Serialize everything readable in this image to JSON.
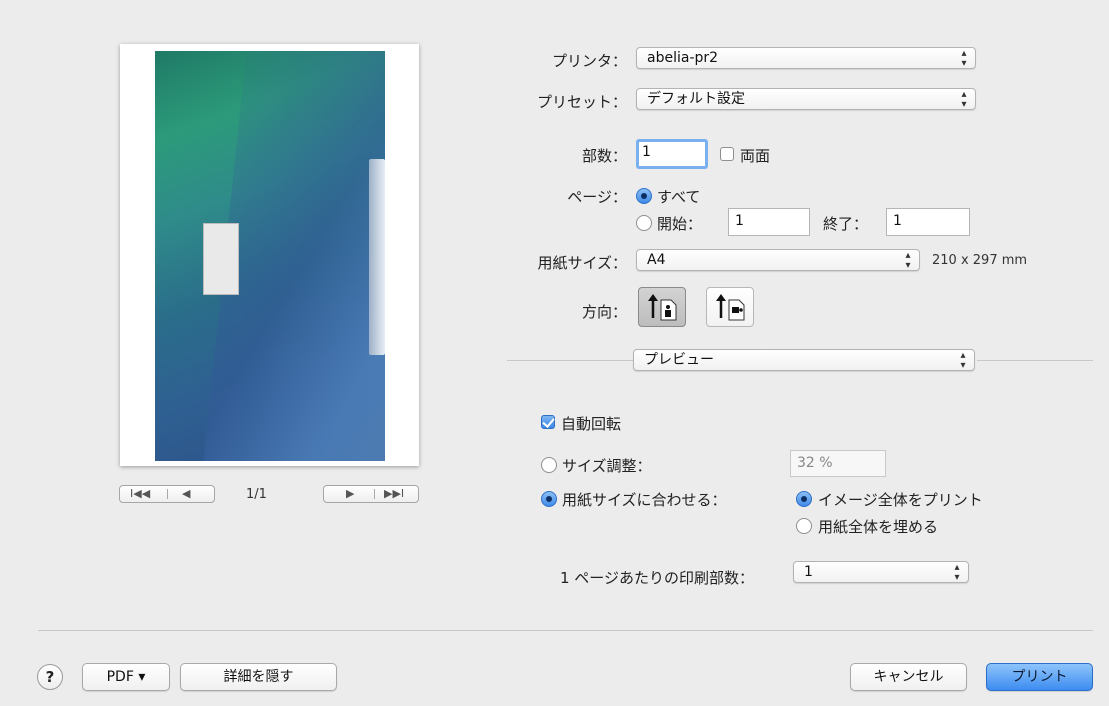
{
  "printer": {
    "label": "プリンタ：",
    "value": "abelia-pr2"
  },
  "preset": {
    "label": "プリセット：",
    "value": "デフォルト設定"
  },
  "copies": {
    "label": "部数：",
    "value": "1",
    "duplex_label": "両面",
    "duplex_checked": false
  },
  "pages": {
    "label": "ページ：",
    "all_label": "すべて",
    "range_label": "開始：",
    "from_value": "1",
    "to_label": "終了：",
    "to_value": "1",
    "selected": "all"
  },
  "paper_size": {
    "label": "用紙サイズ：",
    "value": "A4",
    "dimensions": "210 x 297 mm"
  },
  "orientation": {
    "label": "方向：",
    "selected": "portrait",
    "options": [
      "portrait",
      "landscape"
    ]
  },
  "section_popup": {
    "value": "プレビュー"
  },
  "preview_settings": {
    "auto_rotate": {
      "label": "自動回転",
      "checked": true
    },
    "scale": {
      "label": "サイズ調整：",
      "value": "32 %",
      "selected": false
    },
    "fit": {
      "label": "用紙サイズに合わせる：",
      "selected": true
    },
    "fit_options": [
      {
        "label": "イメージ全体をプリント",
        "selected": true
      },
      {
        "label": "用紙全体を埋める",
        "selected": false
      }
    ],
    "pages_per_sheet": {
      "label": "1 ページあたりの印刷部数：",
      "value": "1"
    }
  },
  "preview_nav": {
    "first": "I◀◀",
    "prev": "◀",
    "page_indicator": "1/1",
    "next": "▶",
    "last": "▶▶I"
  },
  "footer": {
    "help": "?",
    "pdf_label": "PDF ▾",
    "hide_details_label": "詳細を隠す",
    "cancel_label": "キャンセル",
    "print_label": "プリント"
  },
  "icons": [
    "help-icon",
    "portrait-icon",
    "landscape-icon",
    "popup-arrows-icon"
  ],
  "colors": {
    "accent": "#3c8cf0",
    "background": "#ececec"
  }
}
